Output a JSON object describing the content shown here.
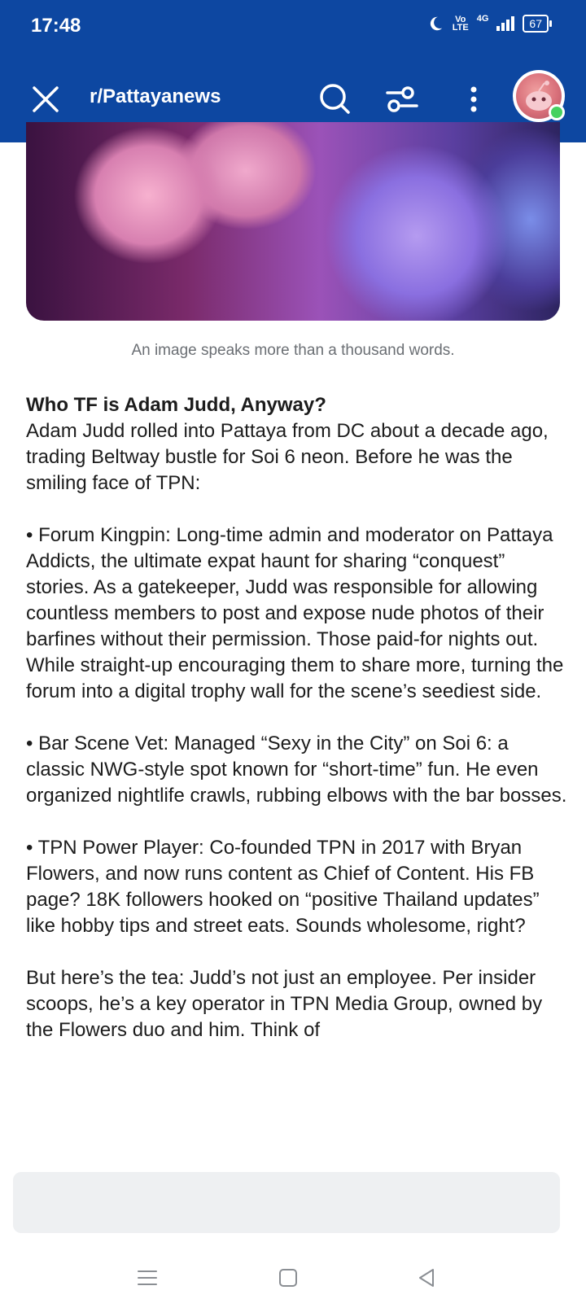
{
  "status_bar": {
    "time": "17:48",
    "volte": "Vo\nLTE",
    "network": "4G",
    "battery": "67"
  },
  "toolbar": {
    "subreddit": "r/Pattayanews",
    "icons": [
      "close-icon",
      "search-icon",
      "filter-icon",
      "more-vert-icon",
      "avatar"
    ]
  },
  "post": {
    "image_caption": "An image speaks more than a thousand words.",
    "heading": "Who TF is Adam Judd, Anyway?",
    "paragraphs": [
      "Adam Judd rolled into Pattaya from DC about a decade ago, trading Beltway bustle for Soi 6 neon. Before he was the smiling face of TPN:",
      "• Forum Kingpin: Long-time admin and moderator on Pattaya Addicts, the ultimate expat haunt for sharing “conquest” stories. As a gatekeeper, Judd was responsible for allowing countless members to post and expose nude photos of their barfines without their permission. Those paid-for nights out. While straight-up encouraging them to share more, turning the forum into a digital trophy wall for the scene’s seediest side.",
      "• Bar Scene Vet: Managed “Sexy in the City” on Soi 6: a classic NWG-style spot known for “short-time” fun. He even organized nightlife crawls, rubbing elbows with the bar bosses.",
      "• TPN Power Player: Co-founded TPN in 2017 with Bryan Flowers, and now runs content as Chief of Content. His FB page? 18K followers hooked on “positive Thailand updates” like hobby tips and street eats. Sounds wholesome, right?",
      "But here’s the tea: Judd’s not just an employee. Per insider scoops, he’s a key operator in TPN Media Group, owned by the Flowers duo and him. Think of"
    ]
  },
  "colors": {
    "header_bg": "#0d47a1",
    "online_dot": "#46d160",
    "caption": "#6b6f74"
  }
}
